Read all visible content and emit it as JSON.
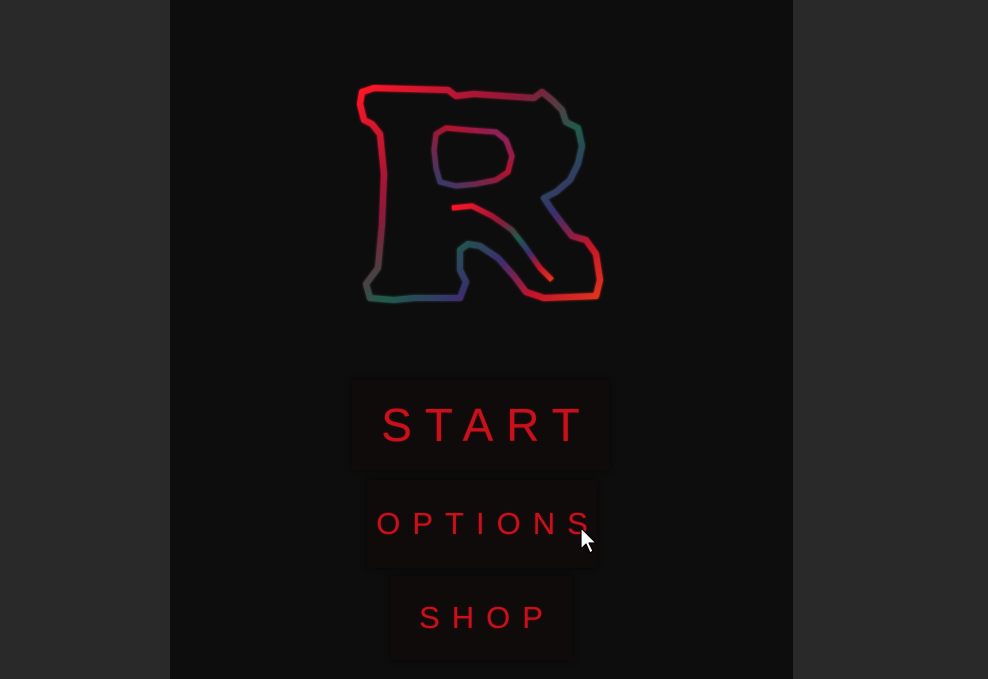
{
  "game": {
    "logo_letter": "R",
    "menu": {
      "start_label": "START",
      "options_label": "OPTIONS",
      "shop_label": "SHOP"
    }
  },
  "icons": {
    "logo": "r-logo-icon",
    "cursor": "mouse-pointer-icon"
  },
  "colors": {
    "menu_text": "#c8111b",
    "viewport_bg": "#0d0d0d",
    "letterbox_bg": "#292929",
    "logo_gradient": [
      "#e0101e",
      "#1f6b4c",
      "#2a3f6e",
      "#c8111b",
      "#e0351e"
    ]
  }
}
